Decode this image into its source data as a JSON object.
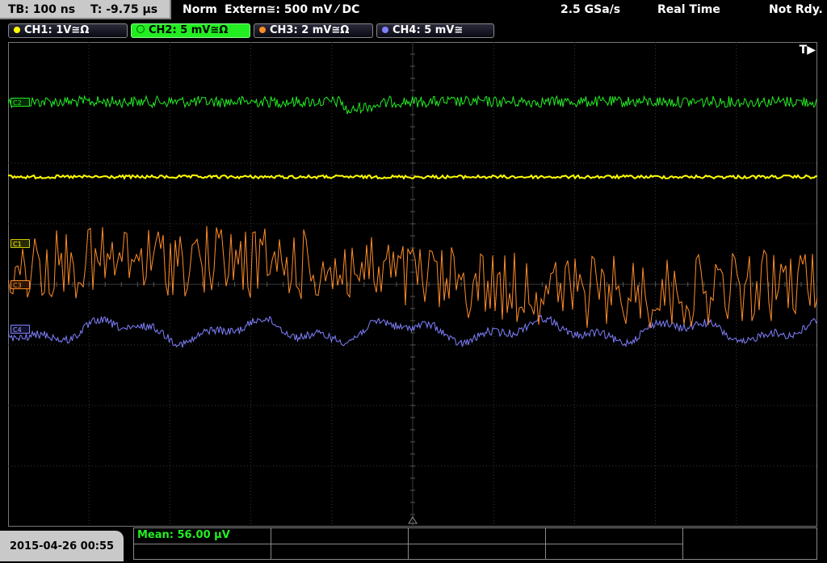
{
  "topbar": {
    "timebase": "TB: 100 ns",
    "trigger_time": "T: -9.75 µs",
    "mode": "Norm",
    "trigger_source": "Extern≅: 500 mV ⁄ DC",
    "sample_rate": "2.5 GSa/s",
    "acq_mode": "Real Time",
    "status": "Not Rdy."
  },
  "channels": [
    {
      "label": "CH1: 1V≅Ω",
      "color": "#ffff00",
      "active": false
    },
    {
      "label": "CH2: 5 mV≅Ω",
      "color": "#22ee22",
      "active": true
    },
    {
      "label": "CH3: 2 mV≅Ω",
      "color": "#ff8c28",
      "active": false
    },
    {
      "label": "CH4: 5 mV≅",
      "color": "#8080ff",
      "active": false
    }
  ],
  "markers": {
    "c2": "C2",
    "c1": "C1",
    "c3": "C3",
    "c4": "C4"
  },
  "trigger_marker": "T▶",
  "measurement": {
    "mean": "Mean: 56.00 µV"
  },
  "datetime": "2015-04-26 00:55"
}
